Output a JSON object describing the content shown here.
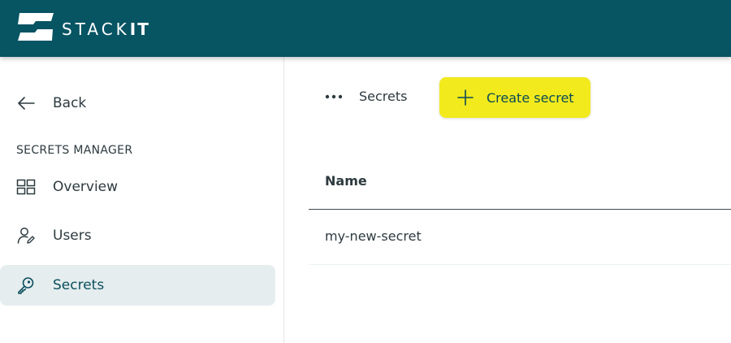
{
  "header": {
    "brand": {
      "light": "STACK",
      "bold": "IT"
    },
    "background_color": "#075463"
  },
  "sidebar": {
    "back_label": "Back",
    "section_title": "SECRETS MANAGER",
    "items": [
      {
        "label": "Overview",
        "icon": "grid-icon",
        "active": false
      },
      {
        "label": "Users",
        "icon": "user-edit-icon",
        "active": false
      },
      {
        "label": "Secrets",
        "icon": "key-icon",
        "active": true
      }
    ],
    "active_background": "#e5edef"
  },
  "main": {
    "breadcrumb": "Secrets",
    "create_button_label": "Create secret",
    "create_button_color": "#f2ea1c",
    "table": {
      "columns": [
        "Name"
      ],
      "rows": [
        {
          "name": "my-new-secret"
        }
      ]
    }
  }
}
